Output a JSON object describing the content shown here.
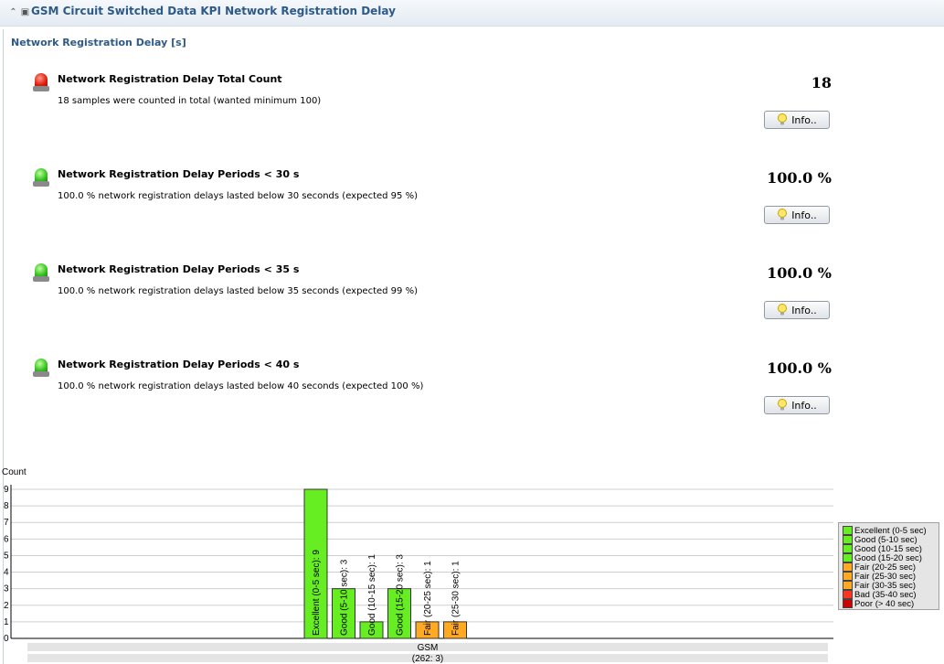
{
  "header": {
    "title": "GSM Circuit Switched Data KPI Network Registration Delay",
    "collapse_icon": "double-chevron-up-icon",
    "window_icon": "restore-window-icon"
  },
  "section_title": "Network Registration Delay [s]",
  "kpis": [
    {
      "status": "red",
      "title": "Network Registration Delay Total Count",
      "description": "18 samples were counted in total (wanted minimum 100)",
      "value": "18",
      "button_label": "Info.."
    },
    {
      "status": "green",
      "title": "Network Registration Delay Periods < 30 s",
      "description": "100.0 % network registration delays lasted below 30 seconds (expected 95 %)",
      "value": "100.0 %",
      "button_label": "Info.."
    },
    {
      "status": "green",
      "title": "Network Registration Delay Periods < 35 s",
      "description": "100.0 % network registration delays lasted below 35 seconds (expected 99 %)",
      "value": "100.0 %",
      "button_label": "Info.."
    },
    {
      "status": "green",
      "title": "Network Registration Delay Periods < 40 s",
      "description": "100.0 % network registration delays lasted below 40 seconds (expected 100 %)",
      "value": "100.0 %",
      "button_label": "Info.."
    }
  ],
  "status_colors": {
    "red": "#e01e0e",
    "green": "#35c21f"
  },
  "chart_data": {
    "type": "bar",
    "ylabel": "Count",
    "ylim": [
      0,
      9
    ],
    "yticks": [
      0,
      1,
      2,
      3,
      4,
      5,
      6,
      7,
      8,
      9
    ],
    "grid": true,
    "x_category": "GSM",
    "x_sublabel": "(262: 3)",
    "bars": [
      {
        "label": "Excellent (0-5 sec): 9",
        "value": 9,
        "color": "#66ee22"
      },
      {
        "label": "Good (5-10 sec): 3",
        "value": 3,
        "color": "#66ee22"
      },
      {
        "label": "Good (10-15 sec): 1",
        "value": 1,
        "color": "#66ee22"
      },
      {
        "label": "Good (15-20 sec): 3",
        "value": 3,
        "color": "#66ee22"
      },
      {
        "label": "Fair (20-25 sec): 1",
        "value": 1,
        "color": "#ffaa22"
      },
      {
        "label": "Fair (25-30 sec): 1",
        "value": 1,
        "color": "#ffaa22"
      }
    ],
    "legend_position": "right",
    "legend": [
      {
        "label": "Excellent (0-5 sec)",
        "color": "#66ee22"
      },
      {
        "label": "Good (5-10 sec)",
        "color": "#66ee22"
      },
      {
        "label": "Good (10-15 sec)",
        "color": "#66ee22"
      },
      {
        "label": "Good (15-20 sec)",
        "color": "#66ee22"
      },
      {
        "label": "Fair (20-25 sec)",
        "color": "#ffaa22"
      },
      {
        "label": "Fair (25-30 sec)",
        "color": "#ffaa22"
      },
      {
        "label": "Fair (30-35 sec)",
        "color": "#ffaa22"
      },
      {
        "label": "Bad (35-40 sec)",
        "color": "#ff3322"
      },
      {
        "label": "Poor (> 40 sec)",
        "color": "#cc0000"
      }
    ]
  }
}
